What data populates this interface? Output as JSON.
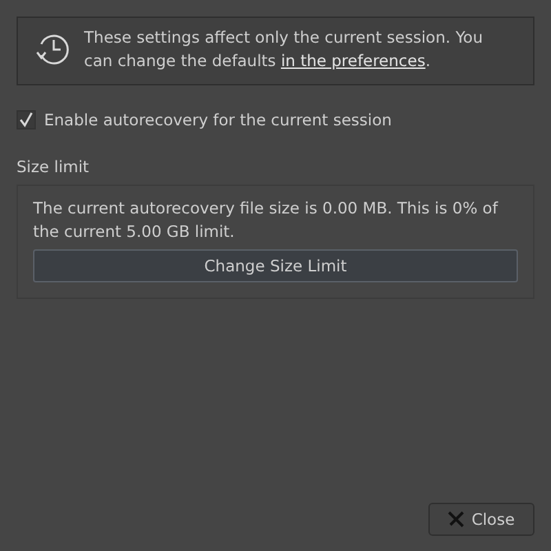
{
  "notice": {
    "text": "These settings affect only the current session. You can change the defaults ",
    "link": "in the preferences",
    "text_end": "."
  },
  "autorecovery_checkbox": {
    "label": "Enable autorecovery for the current session",
    "checked": true
  },
  "size_limit": {
    "title": "Size limit",
    "description": "The current autorecovery file size is 0.00 MB. This is 0% of the current 5.00 GB limit.",
    "button": "Change Size Limit"
  },
  "buttons": [
    {
      "label": "Close"
    }
  ]
}
